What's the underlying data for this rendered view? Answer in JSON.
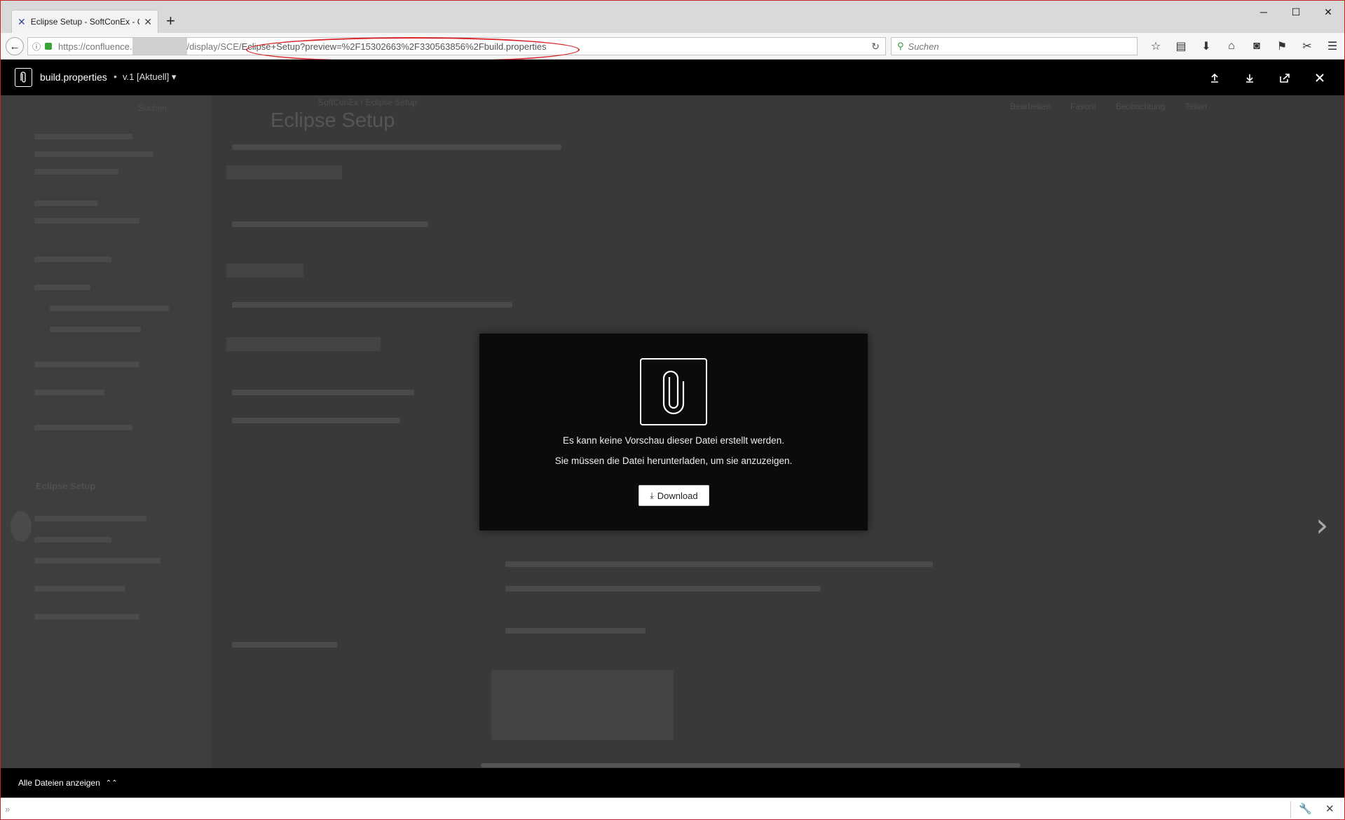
{
  "browser": {
    "tab": {
      "title": "Eclipse Setup - SoftConEx - C",
      "close": "✕"
    },
    "new_tab": "+",
    "window_controls": {
      "minimize": "─",
      "maximize": "☐",
      "close": "✕"
    },
    "url": {
      "prefix": "https://confluence.",
      "middle": "/display/SCE/",
      "suffix": "Eclipse+Setup?preview=%2F15302663%2F330563856%2Fbuild.properties"
    },
    "search_placeholder": "Suchen"
  },
  "viewer": {
    "file_name": "build.properties",
    "separator": "•",
    "version": "v.1 [Aktuell] ▾",
    "show_all_files": "Alle Dateien anzeigen"
  },
  "background": {
    "search": "Suchen",
    "sidebar_title": "Eclipse Setup",
    "page_title": "Eclipse Setup",
    "breadcrumb": "SoftConEx / Eclipse Setup",
    "actions": [
      "Bearbeiten",
      "Favorit",
      "Beobachtung",
      "Teilen"
    ]
  },
  "dialog": {
    "line1": "Es kann keine Vorschau dieser Datei erstellt werden.",
    "line2": "Sie müssen die Datei herunterladen, um sie anzuzeigen.",
    "download_label": "Download"
  },
  "findbar": {
    "prompt": "»"
  },
  "colors": {
    "annotation_red": "#d8262b",
    "viewer_black": "#000000",
    "overlay_gray": "#393939"
  }
}
